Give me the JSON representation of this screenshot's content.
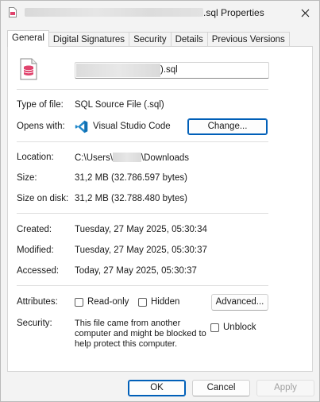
{
  "window": {
    "title_suffix": ".sql Properties",
    "close_glyph": "✕"
  },
  "tabs": [
    {
      "label": "General",
      "active": true
    },
    {
      "label": "Digital Signatures",
      "active": false
    },
    {
      "label": "Security",
      "active": false
    },
    {
      "label": "Details",
      "active": false
    },
    {
      "label": "Previous Versions",
      "active": false
    }
  ],
  "general": {
    "file_name_suffix": ").sql",
    "type_of_file_label": "Type of file:",
    "type_of_file_value": "SQL Source File (.sql)",
    "opens_with_label": "Opens with:",
    "opens_with_value": "Visual Studio Code",
    "change_button": "Change...",
    "location_label": "Location:",
    "location_prefix": "C:\\Users\\",
    "location_suffix": "\\Downloads",
    "size_label": "Size:",
    "size_value": "31,2 MB (32.786.597 bytes)",
    "size_on_disk_label": "Size on disk:",
    "size_on_disk_value": "31,2 MB (32.788.480 bytes)",
    "created_label": "Created:",
    "created_value": "Tuesday, 27 May 2025, 05:30:34",
    "modified_label": "Modified:",
    "modified_value": "Tuesday, 27 May 2025, 05:30:37",
    "accessed_label": "Accessed:",
    "accessed_value": "Today, 27 May 2025, 05:30:37",
    "attributes_label": "Attributes:",
    "readonly_label": "Read-only",
    "hidden_label": "Hidden",
    "advanced_button": "Advanced...",
    "security_label": "Security:",
    "security_text": "This file came from another computer and might be blocked to help protect this computer.",
    "unblock_label": "Unblock"
  },
  "buttons": {
    "ok": "OK",
    "cancel": "Cancel",
    "apply": "Apply"
  },
  "icons": {
    "file": "sql-file-icon",
    "opens_with": "vscode-icon",
    "close": "close-icon"
  },
  "colors": {
    "accent": "#005fb8",
    "vscode_blue": "#2489ca",
    "sql_icon_pink": "#e0456e"
  }
}
